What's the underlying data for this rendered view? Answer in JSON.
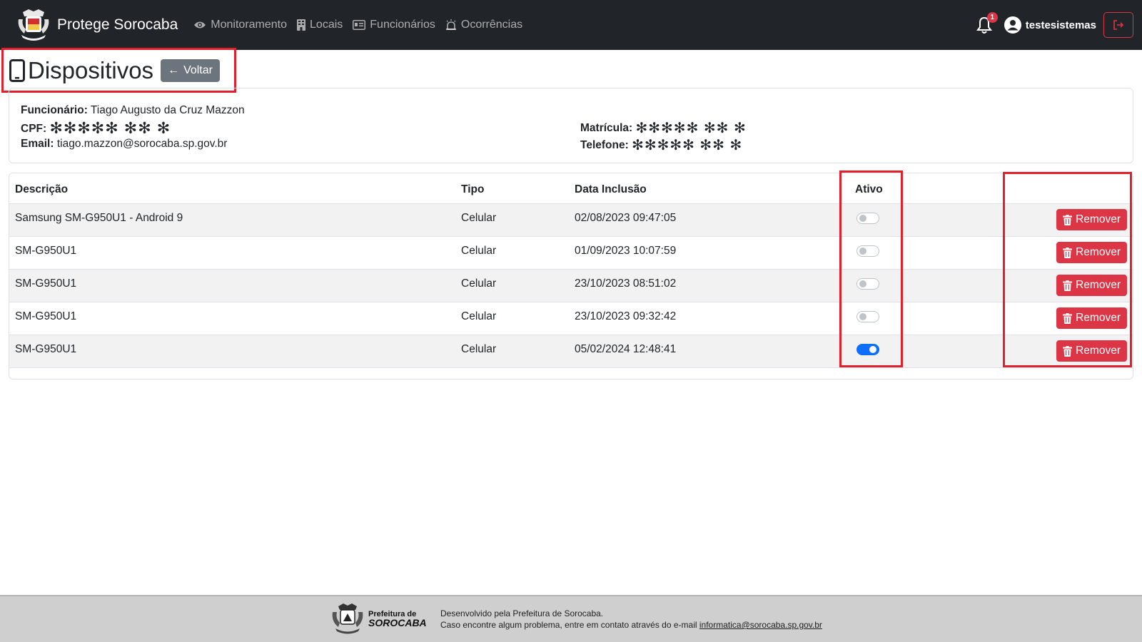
{
  "navbar": {
    "brand": "Protege Sorocaba",
    "links": [
      {
        "label": "Monitoramento",
        "icon": "eye-icon"
      },
      {
        "label": "Locais",
        "icon": "building-icon"
      },
      {
        "label": "Funcionários",
        "icon": "id-card-icon"
      },
      {
        "label": "Ocorrências",
        "icon": "siren-icon"
      }
    ],
    "notification_count": "1",
    "username": "testesistemas"
  },
  "header": {
    "title": "Dispositivos",
    "back_label": "Voltar"
  },
  "employee": {
    "funcionario_label": "Funcionário:",
    "funcionario_value": "Tiago Augusto da Cruz Mazzon",
    "cpf_label": "CPF:",
    "cpf_value": "✻✻✻✻✻ ✻✻ ✻",
    "email_label": "Email:",
    "email_value": "tiago.mazzon@sorocaba.sp.gov.br",
    "matricula_label": "Matrícula:",
    "matricula_value": "✻✻✻✻✻ ✻✻ ✻",
    "telefone_label": "Telefone:",
    "telefone_value": "✻✻✻✻✻ ✻✻ ✻"
  },
  "table": {
    "headers": [
      "Descrição",
      "Tipo",
      "Data Inclusão",
      "Ativo",
      ""
    ],
    "remove_label": "Remover",
    "rows": [
      {
        "descricao": "Samsung SM-G950U1 - Android 9",
        "tipo": "Celular",
        "data": "02/08/2023 09:47:05",
        "ativo": false
      },
      {
        "descricao": "SM-G950U1",
        "tipo": "Celular",
        "data": "01/09/2023 10:07:59",
        "ativo": false
      },
      {
        "descricao": "SM-G950U1",
        "tipo": "Celular",
        "data": "23/10/2023 08:51:02",
        "ativo": false
      },
      {
        "descricao": "SM-G950U1",
        "tipo": "Celular",
        "data": "23/10/2023 09:32:42",
        "ativo": false
      },
      {
        "descricao": "SM-G950U1",
        "tipo": "Celular",
        "data": "05/02/2024 12:48:41",
        "ativo": true
      }
    ]
  },
  "footer": {
    "logo_line1": "Prefeitura de",
    "logo_line2": "SOROCABA",
    "line1": "Desenvolvido pela Prefeitura de Sorocaba.",
    "line2": "Caso encontre algum problema, entre em contato através do e-mail",
    "email": "informatica@sorocaba.sp.gov.br"
  },
  "colors": {
    "navbar": "#212529",
    "danger": "#dc3545",
    "primary": "#0d6efd",
    "secondary": "#6c757d",
    "highlight": "#e0202d"
  }
}
